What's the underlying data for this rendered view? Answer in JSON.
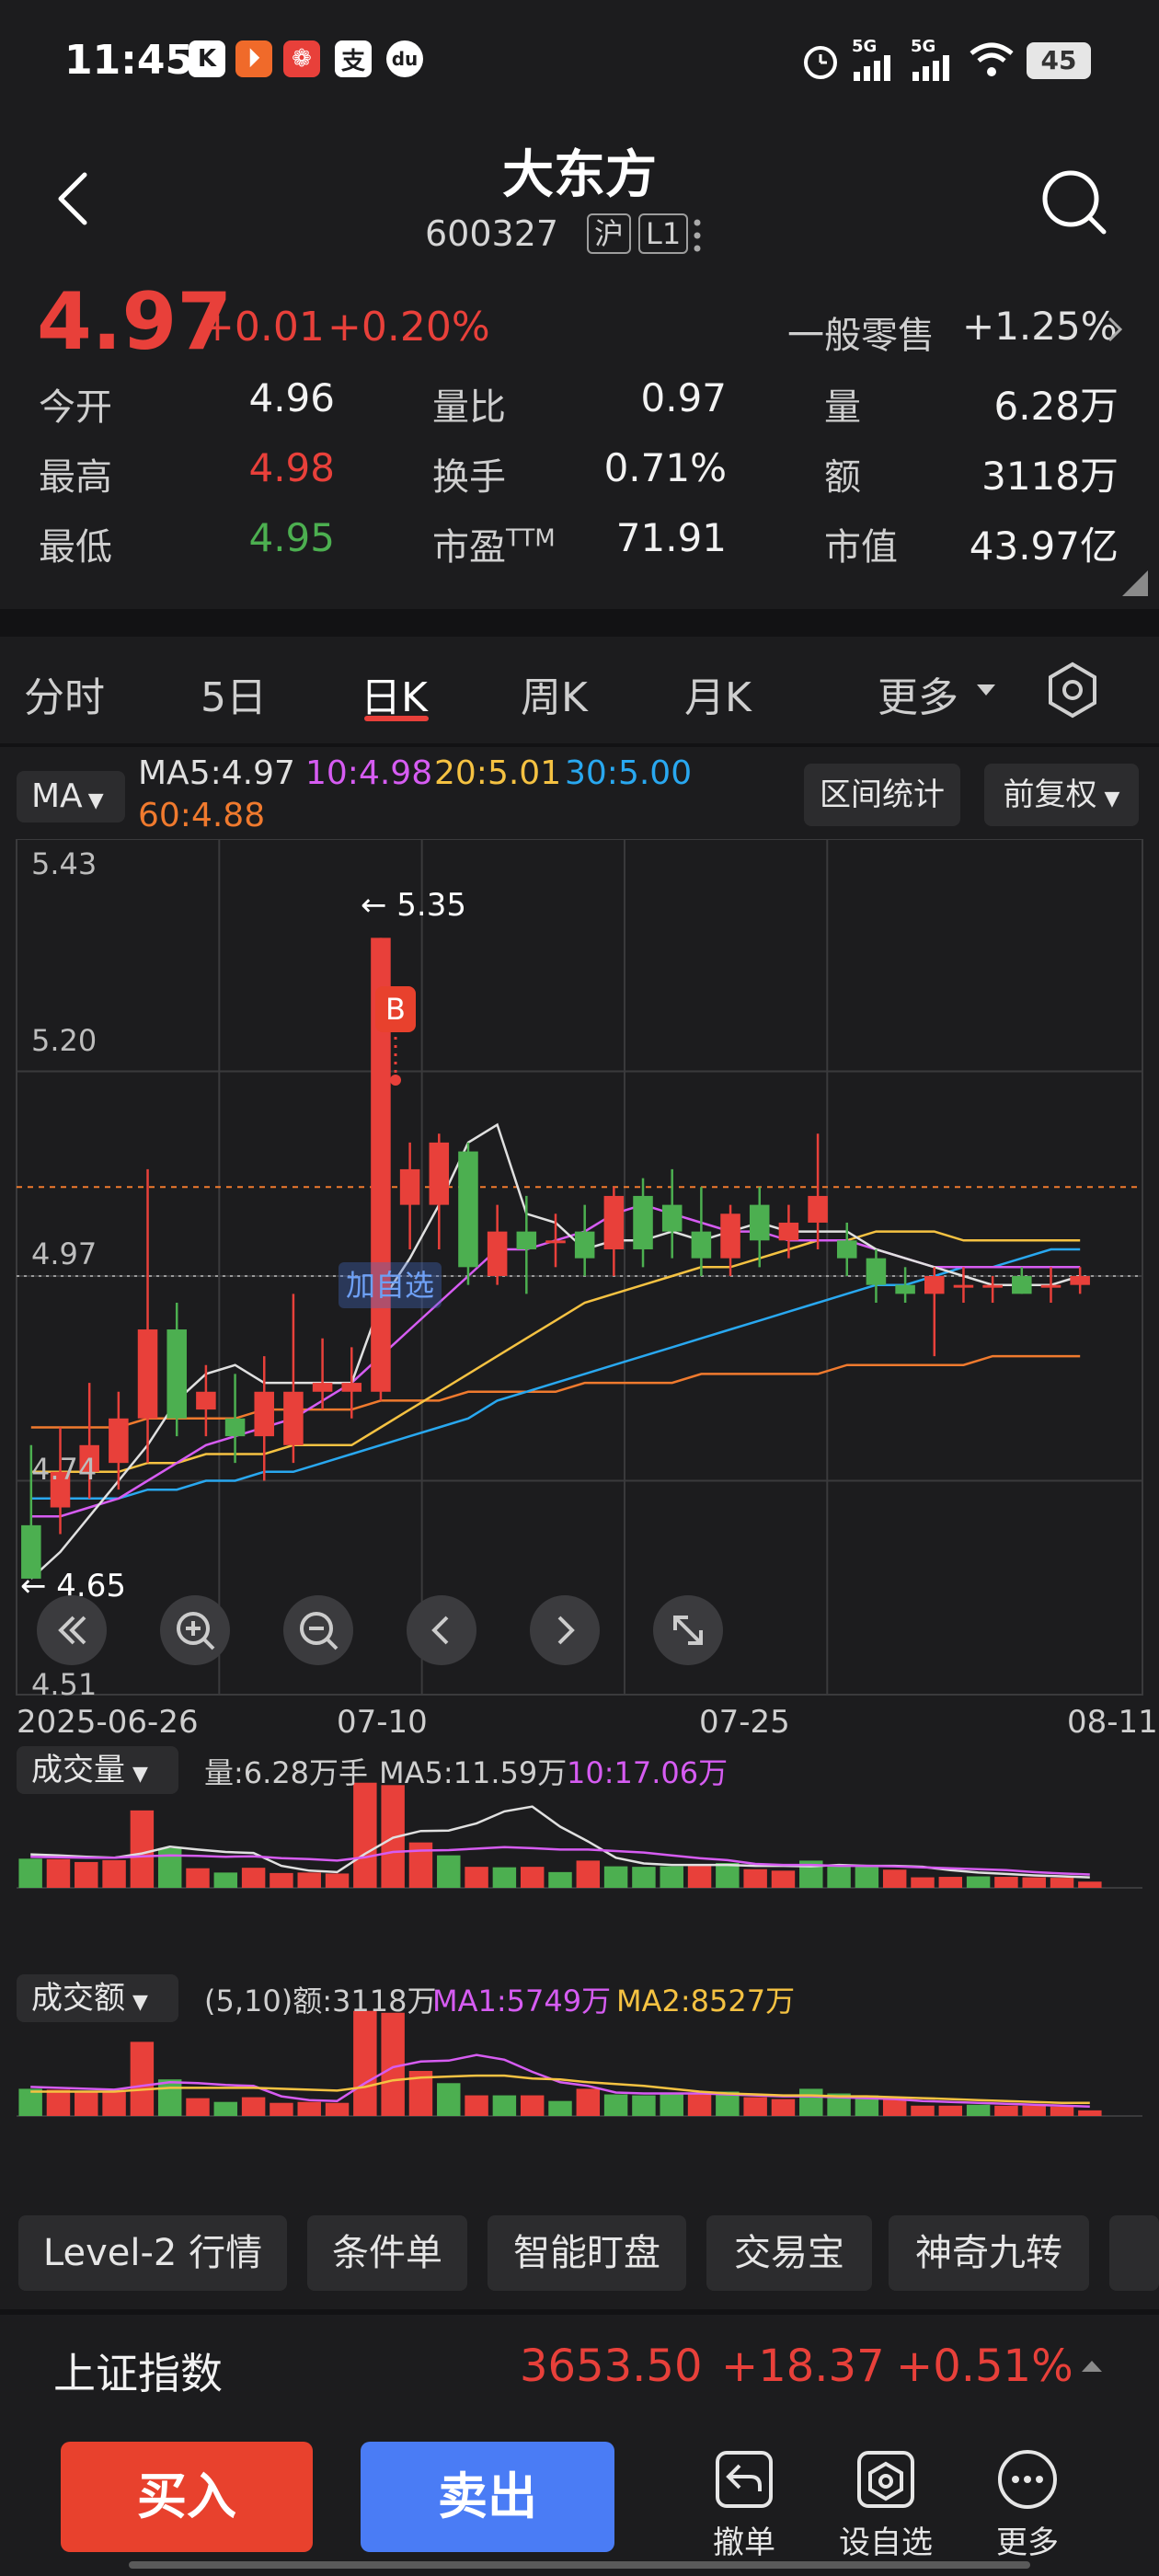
{
  "status_bar": {
    "time": "11:45",
    "app_icons": [
      "K",
      "⏵",
      "❁",
      "支",
      "du"
    ],
    "signal_labels": [
      "5G",
      "5G"
    ],
    "battery": "45"
  },
  "header": {
    "title": "大东方",
    "code": "600327",
    "market_tag": "沪",
    "level_tag": "L1"
  },
  "quote": {
    "price": "4.97",
    "change": "+0.01",
    "change_pct": "+0.20%",
    "sector_name": "一般零售",
    "sector_change": "+1.25%",
    "rows": [
      {
        "l1": "今开",
        "v1": "4.96",
        "l2": "量比",
        "v2": "0.97",
        "l3": "量",
        "v3": "6.28万"
      },
      {
        "l1": "最高",
        "v1": "4.98",
        "l2": "换手",
        "v2": "0.71%",
        "l3": "额",
        "v3": "3118万"
      },
      {
        "l1": "最低",
        "v1": "4.95",
        "l2": "市盈",
        "l2_sup": "TTM",
        "v2": "71.91",
        "l3": "市值",
        "v3": "43.97亿"
      }
    ]
  },
  "tabs": [
    "分时",
    "5日",
    "日K",
    "周K",
    "月K",
    "更多"
  ],
  "chart_header": {
    "ma_select": "MA",
    "ma5": "MA5:4.97",
    "ma10": "10:4.98",
    "ma20": "20:5.01",
    "ma30": "30:5.00",
    "ma60": "60:4.88",
    "range_stats": "区间统计",
    "adjust": "前复权"
  },
  "colors": {
    "up": "#e8403a",
    "down": "#4caf50",
    "ma5": "#e0e0e0",
    "ma10": "#d65cf2",
    "ma20": "#f5c242",
    "ma30": "#29a8f0",
    "ma60": "#f07a2e"
  },
  "kline_axis": {
    "y_labels": [
      "5.43",
      "5.20",
      "4.97",
      "4.74",
      "4.51"
    ],
    "x_labels": [
      "2025-06-26",
      "07-10",
      "07-25",
      "08-11"
    ],
    "high_marker": "5.35",
    "low_marker": "4.65",
    "buy_marker": "B",
    "add_marker": "加自选"
  },
  "chart_data": [
    {
      "type": "candlestick",
      "title": "",
      "ylim": [
        4.51,
        5.43
      ],
      "candles": [
        {
          "o": 4.69,
          "h": 4.78,
          "l": 4.64,
          "c": 4.63
        },
        {
          "o": 4.71,
          "h": 4.8,
          "l": 4.68,
          "c": 4.75
        },
        {
          "o": 4.75,
          "h": 4.85,
          "l": 4.72,
          "c": 4.78
        },
        {
          "o": 4.76,
          "h": 4.84,
          "l": 4.73,
          "c": 4.81
        },
        {
          "o": 4.81,
          "h": 5.09,
          "l": 4.76,
          "c": 4.91
        },
        {
          "o": 4.91,
          "h": 4.94,
          "l": 4.79,
          "c": 4.81
        },
        {
          "o": 4.82,
          "h": 4.87,
          "l": 4.79,
          "c": 4.84
        },
        {
          "o": 4.81,
          "h": 4.86,
          "l": 4.76,
          "c": 4.79
        },
        {
          "o": 4.79,
          "h": 4.88,
          "l": 4.74,
          "c": 4.84
        },
        {
          "o": 4.78,
          "h": 4.95,
          "l": 4.76,
          "c": 4.84
        },
        {
          "o": 4.84,
          "h": 4.9,
          "l": 4.82,
          "c": 4.85
        },
        {
          "o": 4.84,
          "h": 4.89,
          "l": 4.81,
          "c": 4.85
        },
        {
          "o": 4.84,
          "h": 5.35,
          "l": 4.83,
          "c": 5.35
        },
        {
          "o": 5.05,
          "h": 5.12,
          "l": 5.0,
          "c": 5.09
        },
        {
          "o": 5.05,
          "h": 5.13,
          "l": 5.0,
          "c": 5.12
        },
        {
          "o": 5.11,
          "h": 5.12,
          "l": 4.96,
          "c": 4.98
        },
        {
          "o": 4.97,
          "h": 5.05,
          "l": 4.96,
          "c": 5.02
        },
        {
          "o": 5.02,
          "h": 5.06,
          "l": 4.95,
          "c": 5.0
        },
        {
          "o": 5.01,
          "h": 5.04,
          "l": 4.98,
          "c": 5.01
        },
        {
          "o": 5.02,
          "h": 5.05,
          "l": 4.97,
          "c": 4.99
        },
        {
          "o": 5.0,
          "h": 5.07,
          "l": 4.97,
          "c": 5.06
        },
        {
          "o": 5.06,
          "h": 5.08,
          "l": 4.98,
          "c": 5.0
        },
        {
          "o": 5.05,
          "h": 5.09,
          "l": 4.99,
          "c": 5.02
        },
        {
          "o": 5.02,
          "h": 5.07,
          "l": 4.97,
          "c": 4.99
        },
        {
          "o": 4.99,
          "h": 5.05,
          "l": 4.97,
          "c": 5.04
        },
        {
          "o": 5.05,
          "h": 5.07,
          "l": 4.98,
          "c": 5.01
        },
        {
          "o": 5.01,
          "h": 5.05,
          "l": 4.99,
          "c": 5.03
        },
        {
          "o": 5.03,
          "h": 5.13,
          "l": 5.0,
          "c": 5.06
        },
        {
          "o": 5.01,
          "h": 5.03,
          "l": 4.97,
          "c": 4.99
        },
        {
          "o": 4.99,
          "h": 5.0,
          "l": 4.94,
          "c": 4.96
        },
        {
          "o": 4.96,
          "h": 4.98,
          "l": 4.94,
          "c": 4.95
        },
        {
          "o": 4.95,
          "h": 4.98,
          "l": 4.88,
          "c": 4.97
        },
        {
          "o": 4.96,
          "h": 4.98,
          "l": 4.94,
          "c": 4.96
        },
        {
          "o": 4.96,
          "h": 4.97,
          "l": 4.94,
          "c": 4.96
        },
        {
          "o": 4.97,
          "h": 4.98,
          "l": 4.95,
          "c": 4.95
        },
        {
          "o": 4.96,
          "h": 4.98,
          "l": 4.94,
          "c": 4.96
        },
        {
          "o": 4.96,
          "h": 4.98,
          "l": 4.95,
          "c": 4.97
        }
      ],
      "ma5": [
        4.63,
        4.66,
        4.7,
        4.74,
        4.78,
        4.83,
        4.86,
        4.87,
        4.85,
        4.85,
        4.85,
        4.85,
        4.94,
        4.99,
        5.05,
        5.12,
        5.14,
        5.04,
        5.03,
        5.0,
        5.01,
        5.01,
        5.02,
        5.01,
        5.02,
        5.03,
        5.02,
        5.02,
        5.02,
        5.0,
        4.99,
        4.98,
        4.97,
        4.96,
        4.96,
        4.96,
        4.97
      ],
      "ma10": [
        4.7,
        4.7,
        4.71,
        4.72,
        4.74,
        4.76,
        4.78,
        4.79,
        4.8,
        4.81,
        4.83,
        4.85,
        4.88,
        4.91,
        4.94,
        4.97,
        5.0,
        5.0,
        5.01,
        5.02,
        5.04,
        5.05,
        5.04,
        5.03,
        5.02,
        5.02,
        5.01,
        5.01,
        5.01,
        5.0,
        4.99,
        4.98,
        4.98,
        4.98,
        4.98,
        4.98,
        4.98
      ],
      "ma20": [
        4.75,
        4.75,
        4.75,
        4.75,
        4.76,
        4.76,
        4.77,
        4.77,
        4.77,
        4.78,
        4.78,
        4.78,
        4.8,
        4.82,
        4.84,
        4.86,
        4.88,
        4.9,
        4.92,
        4.94,
        4.95,
        4.96,
        4.97,
        4.98,
        4.98,
        4.99,
        5.0,
        5.01,
        5.01,
        5.02,
        5.02,
        5.02,
        5.01,
        5.01,
        5.01,
        5.01,
        5.01
      ],
      "ma30": [
        4.72,
        4.72,
        4.72,
        4.72,
        4.73,
        4.73,
        4.74,
        4.74,
        4.75,
        4.75,
        4.76,
        4.77,
        4.78,
        4.79,
        4.8,
        4.81,
        4.83,
        4.84,
        4.85,
        4.86,
        4.87,
        4.88,
        4.89,
        4.9,
        4.91,
        4.92,
        4.93,
        4.94,
        4.95,
        4.96,
        4.96,
        4.97,
        4.98,
        4.98,
        4.99,
        5.0,
        5.0
      ],
      "ma60": [
        4.8,
        4.8,
        4.8,
        4.8,
        4.81,
        4.81,
        4.81,
        4.81,
        4.82,
        4.82,
        4.82,
        4.82,
        4.83,
        4.83,
        4.83,
        4.84,
        4.84,
        4.84,
        4.84,
        4.85,
        4.85,
        4.85,
        4.85,
        4.86,
        4.86,
        4.86,
        4.86,
        4.86,
        4.87,
        4.87,
        4.87,
        4.87,
        4.87,
        4.88,
        4.88,
        4.88,
        4.88
      ]
    },
    {
      "type": "bar",
      "title": "成交量",
      "values": [
        6.1,
        6.0,
        5.4,
        5.8,
        16.2,
        8.3,
        4.1,
        3.2,
        4.2,
        3.1,
        3.2,
        3.0,
        22.0,
        21.5,
        9.5,
        6.8,
        4.4,
        4.3,
        4.4,
        3.3,
        5.7,
        4.5,
        4.4,
        4.5,
        4.6,
        5.2,
        3.9,
        3.6,
        5.7,
        4.9,
        4.5,
        3.8,
        2.2,
        2.3,
        2.4,
        2.3,
        2.2,
        2.1,
        1.3
      ],
      "ma5": [
        7.0,
        6.8,
        6.5,
        6.3,
        7.2,
        8.6,
        8.0,
        7.5,
        7.3,
        4.6,
        3.6,
        3.3,
        7.1,
        10.5,
        11.9,
        12.0,
        13.5,
        16.0,
        17.0,
        12.8,
        9.7,
        6.3,
        5.1,
        4.8,
        4.8,
        4.8,
        4.6,
        4.6,
        4.5,
        4.8,
        4.6,
        4.6,
        4.4,
        3.7,
        3.2,
        2.9,
        2.6,
        2.4,
        2.2
      ],
      "ma10": [
        6.5,
        6.4,
        6.3,
        6.3,
        6.6,
        6.8,
        6.7,
        6.5,
        6.6,
        6.2,
        6.0,
        5.7,
        6.4,
        7.5,
        7.8,
        7.9,
        8.2,
        8.5,
        8.3,
        8.0,
        8.0,
        7.7,
        7.4,
        6.8,
        6.2,
        5.8,
        5.0,
        4.8,
        4.8,
        4.6,
        4.6,
        4.5,
        4.3,
        4.1,
        3.9,
        3.7,
        3.3,
        3.0,
        2.8
      ],
      "volume_label": "量:6.28万手",
      "ma5_label": "MA5:11.59万",
      "ma10_label": "10:17.06万"
    },
    {
      "type": "bar",
      "title": "成交额",
      "values": [
        2.9,
        2.8,
        2.5,
        2.7,
        7.9,
        3.9,
        1.9,
        1.5,
        2.0,
        1.4,
        1.5,
        1.4,
        11.2,
        11.0,
        4.8,
        3.5,
        2.2,
        2.2,
        2.2,
        1.6,
        2.9,
        2.3,
        2.2,
        2.3,
        2.3,
        2.6,
        2.0,
        1.8,
        2.9,
        2.4,
        2.2,
        1.9,
        1.1,
        1.1,
        1.2,
        1.1,
        1.1,
        1.0,
        0.6
      ],
      "ma1": [
        3.1,
        3.0,
        2.9,
        2.8,
        3.2,
        3.6,
        3.5,
        3.3,
        3.2,
        2.1,
        1.7,
        1.6,
        3.5,
        5.2,
        5.8,
        5.9,
        6.5,
        6.0,
        4.7,
        3.6,
        3.2,
        2.5,
        2.4,
        2.4,
        2.4,
        2.3,
        2.2,
        2.1,
        2.1,
        2.0,
        1.9,
        1.8,
        1.6,
        1.5,
        1.4,
        1.3,
        1.2,
        1.1,
        1.0
      ],
      "ma2": [
        2.6,
        2.6,
        2.6,
        2.6,
        2.8,
        3.0,
        3.0,
        3.0,
        3.0,
        2.9,
        2.8,
        2.7,
        3.1,
        3.8,
        4.1,
        4.2,
        4.3,
        4.3,
        4.0,
        3.9,
        3.6,
        3.4,
        3.2,
        2.9,
        2.6,
        2.4,
        2.3,
        2.2,
        2.2,
        2.1,
        2.1,
        2.0,
        1.9,
        1.8,
        1.7,
        1.6,
        1.5,
        1.4,
        1.4
      ],
      "amount_label": "(5,10)额:3118万",
      "ma1_label": "MA1:5749万",
      "ma2_label": "MA2:8527万"
    }
  ],
  "feature_buttons": [
    "Level-2 行情",
    "条件单",
    "智能盯盘",
    "交易宝",
    "神奇九转"
  ],
  "index_bar": {
    "name": "上证指数",
    "value": "3653.50",
    "change": "+18.37",
    "change_pct": "+0.51%"
  },
  "actions": {
    "buy": "买入",
    "sell": "卖出",
    "cancel": "撤单",
    "watch": "设自选",
    "more": "更多"
  }
}
